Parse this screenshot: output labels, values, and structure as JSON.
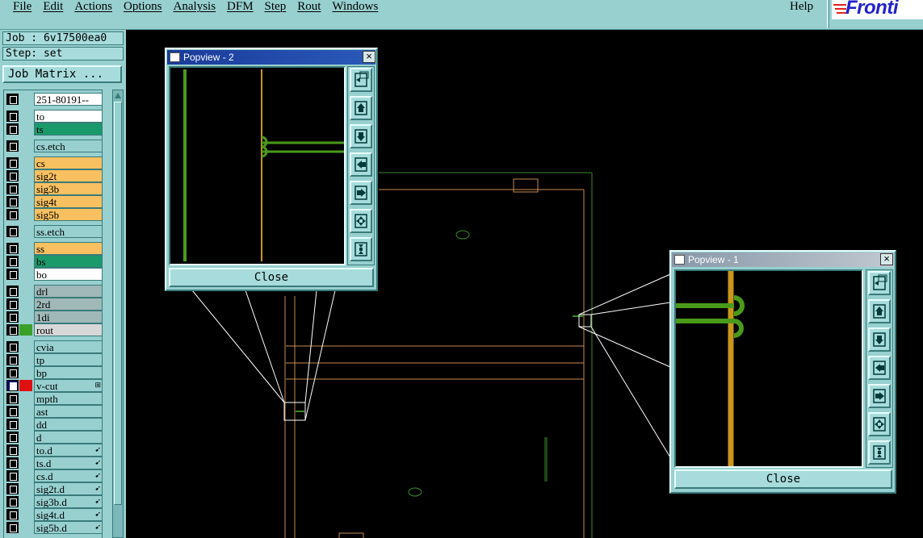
{
  "menubar": {
    "items": [
      "File",
      "Edit",
      "Actions",
      "Options",
      "Analysis",
      "DFM",
      "Step",
      "Rout",
      "Windows"
    ],
    "help": "Help",
    "logo_text": "Fronti"
  },
  "job": {
    "label": "Job : 6v17500ea0"
  },
  "step": {
    "label": "Step: set"
  },
  "job_matrix_button": "Job Matrix ...",
  "layers": [
    {
      "name": "251-80191--",
      "bg": "#ffffff",
      "swatch": null,
      "selected": false,
      "mark": ""
    },
    {
      "name": "to",
      "bg": "#ffffff",
      "swatch": null,
      "selected": false,
      "mark": ""
    },
    {
      "name": "ts",
      "bg": "#1a9a6a",
      "swatch": null,
      "selected": false,
      "mark": ""
    },
    {
      "name": "cs.etch",
      "bg": "#98d0d0",
      "swatch": null,
      "selected": false,
      "mark": ""
    },
    {
      "name": "cs",
      "bg": "#f8c060",
      "swatch": null,
      "selected": false,
      "mark": ""
    },
    {
      "name": "sig2t",
      "bg": "#f8c060",
      "swatch": null,
      "selected": false,
      "mark": ""
    },
    {
      "name": "sig3b",
      "bg": "#f8c060",
      "swatch": null,
      "selected": false,
      "mark": ""
    },
    {
      "name": "sig4t",
      "bg": "#f8c060",
      "swatch": null,
      "selected": false,
      "mark": ""
    },
    {
      "name": "sig5b",
      "bg": "#f8c060",
      "swatch": null,
      "selected": false,
      "mark": ""
    },
    {
      "name": "ss.etch",
      "bg": "#98d0d0",
      "swatch": null,
      "selected": false,
      "mark": ""
    },
    {
      "name": "ss",
      "bg": "#f8c060",
      "swatch": null,
      "selected": false,
      "mark": ""
    },
    {
      "name": "bs",
      "bg": "#1a9a6a",
      "swatch": null,
      "selected": false,
      "mark": ""
    },
    {
      "name": "bo",
      "bg": "#ffffff",
      "swatch": null,
      "selected": false,
      "mark": ""
    },
    {
      "name": "drl",
      "bg": "#a0b8b8",
      "swatch": null,
      "selected": false,
      "mark": ""
    },
    {
      "name": "2rd",
      "bg": "#a0b8b8",
      "swatch": null,
      "selected": false,
      "mark": ""
    },
    {
      "name": "1di",
      "bg": "#a0b8b8",
      "swatch": null,
      "selected": false,
      "mark": ""
    },
    {
      "name": "rout",
      "bg": "#d8d8d8",
      "swatch": "#3aa02a",
      "selected": false,
      "mark": ""
    },
    {
      "name": "cvia",
      "bg": "#98d0d0",
      "swatch": null,
      "selected": false,
      "mark": ""
    },
    {
      "name": "tp",
      "bg": "#98d0d0",
      "swatch": null,
      "selected": false,
      "mark": ""
    },
    {
      "name": "bp",
      "bg": "#98d0d0",
      "swatch": null,
      "selected": false,
      "mark": ""
    },
    {
      "name": "v-cut",
      "bg": "#98d0d0",
      "swatch": "#e01010",
      "selected": true,
      "mark": "⊞"
    },
    {
      "name": "mpth",
      "bg": "#98d0d0",
      "swatch": null,
      "selected": false,
      "mark": ""
    },
    {
      "name": "ast",
      "bg": "#98d0d0",
      "swatch": null,
      "selected": false,
      "mark": ""
    },
    {
      "name": "dd",
      "bg": "#98d0d0",
      "swatch": null,
      "selected": false,
      "mark": ""
    },
    {
      "name": "d",
      "bg": "#98d0d0",
      "swatch": null,
      "selected": false,
      "mark": ""
    },
    {
      "name": "to.d",
      "bg": "#98d0d0",
      "swatch": null,
      "selected": false,
      "mark": "➹"
    },
    {
      "name": "ts.d",
      "bg": "#98d0d0",
      "swatch": null,
      "selected": false,
      "mark": "➹"
    },
    {
      "name": "cs.d",
      "bg": "#98d0d0",
      "swatch": null,
      "selected": false,
      "mark": "➹"
    },
    {
      "name": "sig2t.d",
      "bg": "#98d0d0",
      "swatch": null,
      "selected": false,
      "mark": "➹"
    },
    {
      "name": "sig3b.d",
      "bg": "#98d0d0",
      "swatch": null,
      "selected": false,
      "mark": "➹"
    },
    {
      "name": "sig4t.d",
      "bg": "#98d0d0",
      "swatch": null,
      "selected": false,
      "mark": "➹"
    },
    {
      "name": "sig5b.d",
      "bg": "#98d0d0",
      "swatch": null,
      "selected": false,
      "mark": "➹"
    }
  ],
  "popview2": {
    "title": "Popview - 2",
    "close_label": "Close",
    "tools": [
      "zoom-home-icon",
      "pan-up-icon",
      "pan-down-icon",
      "pan-left-icon",
      "pan-right-icon",
      "zoom-out-icon",
      "zoom-in-icon"
    ]
  },
  "popview1": {
    "title": "Popview - 1",
    "close_label": "Close",
    "tools": [
      "zoom-home-icon",
      "pan-up-icon",
      "pan-down-icon",
      "pan-left-icon",
      "pan-right-icon",
      "zoom-out-icon",
      "zoom-in-icon"
    ]
  },
  "colors": {
    "panel": "#98d0d0",
    "title_active": "#1a3a9a",
    "trace_green": "#4a9a1a",
    "trace_gold": "#c8961a",
    "outline_tan": "#c88a50",
    "outline_green": "#3a8a2a"
  }
}
